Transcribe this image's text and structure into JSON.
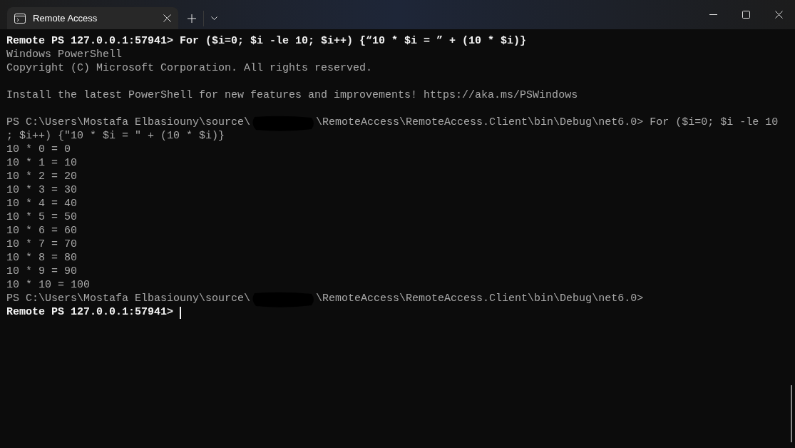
{
  "tab": {
    "title": "Remote Access"
  },
  "terminal": {
    "lines": [
      {
        "kind": "command",
        "text": "Remote PS 127.0.0.1:57941> For ($i=0; $i -le 10; $i++) {“10 * $i = ” + (10 * $i)}"
      },
      {
        "kind": "output",
        "text": "Windows PowerShell"
      },
      {
        "kind": "output",
        "text": "Copyright (C) Microsoft Corporation. All rights reserved."
      },
      {
        "kind": "blank"
      },
      {
        "kind": "output",
        "text": "Install the latest PowerShell for new features and improvements! https://aka.ms/PSWindows"
      },
      {
        "kind": "blank"
      },
      {
        "kind": "redacted",
        "before": "PS C:\\Users\\Mostafa Elbasiouny\\source\\",
        "after": "\\RemoteAccess\\RemoteAccess.Client\\bin\\Debug\\net6.0> For ($i=0; $i -le 10"
      },
      {
        "kind": "output",
        "text": "; $i++) {\"10 * $i = \" + (10 * $i)}"
      },
      {
        "kind": "output",
        "text": "10 * 0 = 0"
      },
      {
        "kind": "output",
        "text": "10 * 1 = 10"
      },
      {
        "kind": "output",
        "text": "10 * 2 = 20"
      },
      {
        "kind": "output",
        "text": "10 * 3 = 30"
      },
      {
        "kind": "output",
        "text": "10 * 4 = 40"
      },
      {
        "kind": "output",
        "text": "10 * 5 = 50"
      },
      {
        "kind": "output",
        "text": "10 * 6 = 60"
      },
      {
        "kind": "output",
        "text": "10 * 7 = 70"
      },
      {
        "kind": "output",
        "text": "10 * 8 = 80"
      },
      {
        "kind": "output",
        "text": "10 * 9 = 90"
      },
      {
        "kind": "output",
        "text": "10 * 10 = 100"
      },
      {
        "kind": "redacted",
        "before": "PS C:\\Users\\Mostafa Elbasiouny\\source\\",
        "after": "\\RemoteAccess\\RemoteAccess.Client\\bin\\Debug\\net6.0>"
      },
      {
        "kind": "command",
        "text": "Remote PS 127.0.0.1:57941>",
        "cursor": true
      }
    ]
  }
}
